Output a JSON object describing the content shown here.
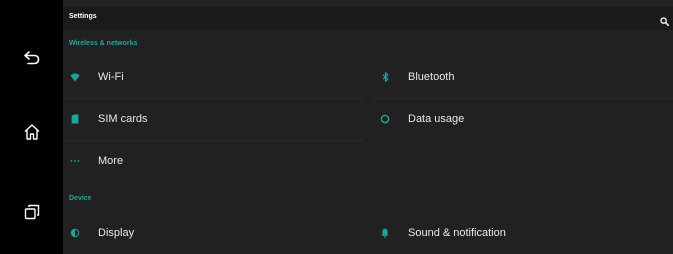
{
  "app_bar": {
    "title": "Settings"
  },
  "sections": [
    {
      "header": "Wireless & networks"
    },
    {
      "header": "Device"
    }
  ],
  "items": {
    "wifi": {
      "label": "Wi-Fi",
      "icon": "wifi-icon"
    },
    "bluetooth": {
      "label": "Bluetooth",
      "icon": "bluetooth-icon"
    },
    "sim_cards": {
      "label": "SIM cards",
      "icon": "sim-card-icon"
    },
    "data_usage": {
      "label": "Data usage",
      "icon": "data-usage-icon"
    },
    "more": {
      "label": "More",
      "icon": "more-dots-icon"
    },
    "display": {
      "label": "Display",
      "icon": "display-brightness-icon"
    },
    "sound": {
      "label": "Sound & notification",
      "icon": "bell-icon"
    }
  },
  "nav_bar": {
    "icons": [
      "back-icon",
      "home-icon",
      "recents-icon"
    ]
  },
  "colors": {
    "accent": "#19a79a",
    "background": "#212121",
    "app_bar": "#1a1a1a",
    "nav_bar": "#000000"
  }
}
